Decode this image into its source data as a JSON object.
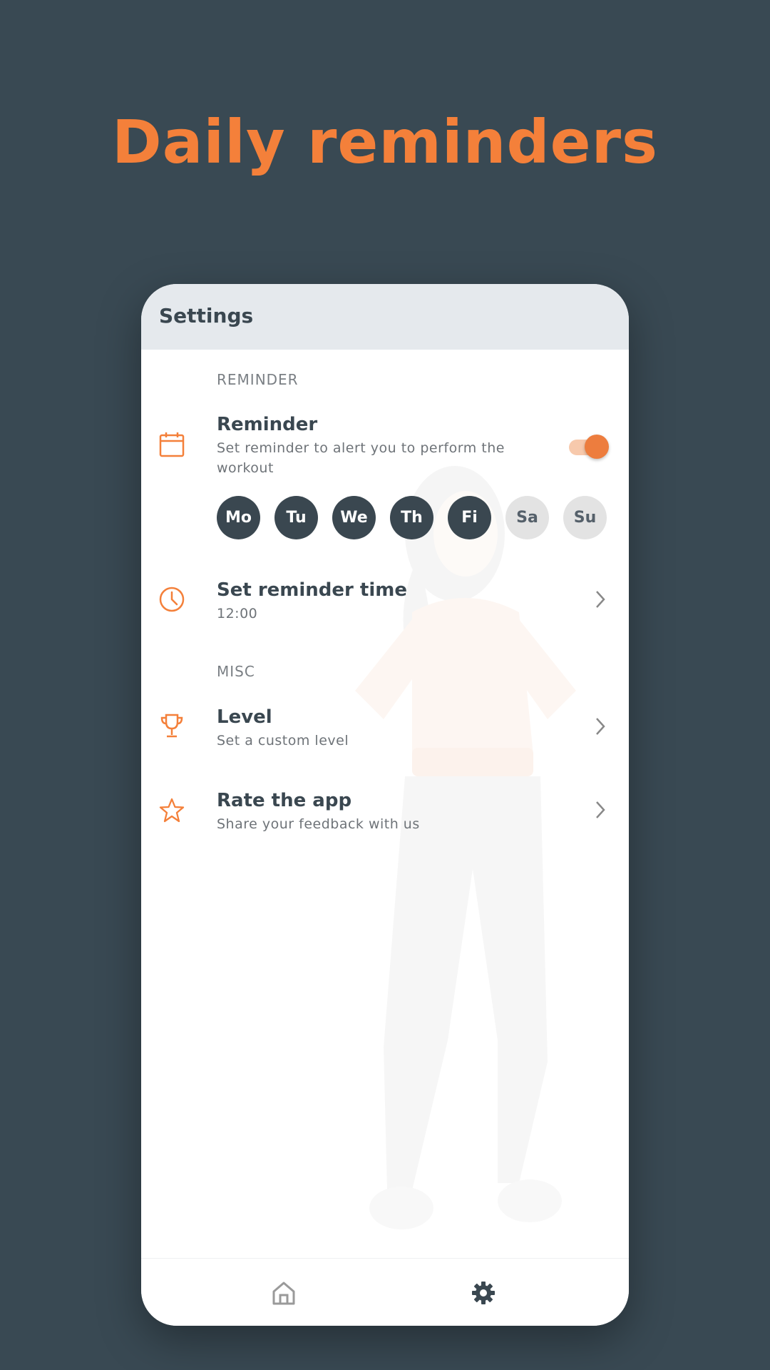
{
  "headline": "Daily reminders",
  "appbar": {
    "title": "Settings"
  },
  "sections": {
    "reminder_label": "REMINDER",
    "misc_label": "MISC"
  },
  "reminder": {
    "title": "Reminder",
    "subtitle": "Set reminder to alert you to perform the workout",
    "icon": "calendar-icon",
    "enabled": true,
    "days": [
      {
        "label": "Mo",
        "selected": true
      },
      {
        "label": "Tu",
        "selected": true
      },
      {
        "label": "We",
        "selected": true
      },
      {
        "label": "Th",
        "selected": true
      },
      {
        "label": "Fi",
        "selected": true
      },
      {
        "label": "Sa",
        "selected": false
      },
      {
        "label": "Su",
        "selected": false
      }
    ]
  },
  "reminder_time": {
    "title": "Set reminder time",
    "value": "12:00",
    "icon": "clock-icon"
  },
  "level": {
    "title": "Level",
    "subtitle": "Set a custom level",
    "icon": "trophy-icon"
  },
  "rate": {
    "title": "Rate the app",
    "subtitle": "Share your feedback with us",
    "icon": "star-icon"
  },
  "nav": {
    "items": [
      "home-icon",
      "settings-gear-icon"
    ]
  },
  "colors": {
    "background": "#394953",
    "accent": "#F4803A",
    "text_dark": "#3A4750",
    "day_selected": "#3A4750",
    "day_unselected": "#E3E3E3"
  }
}
